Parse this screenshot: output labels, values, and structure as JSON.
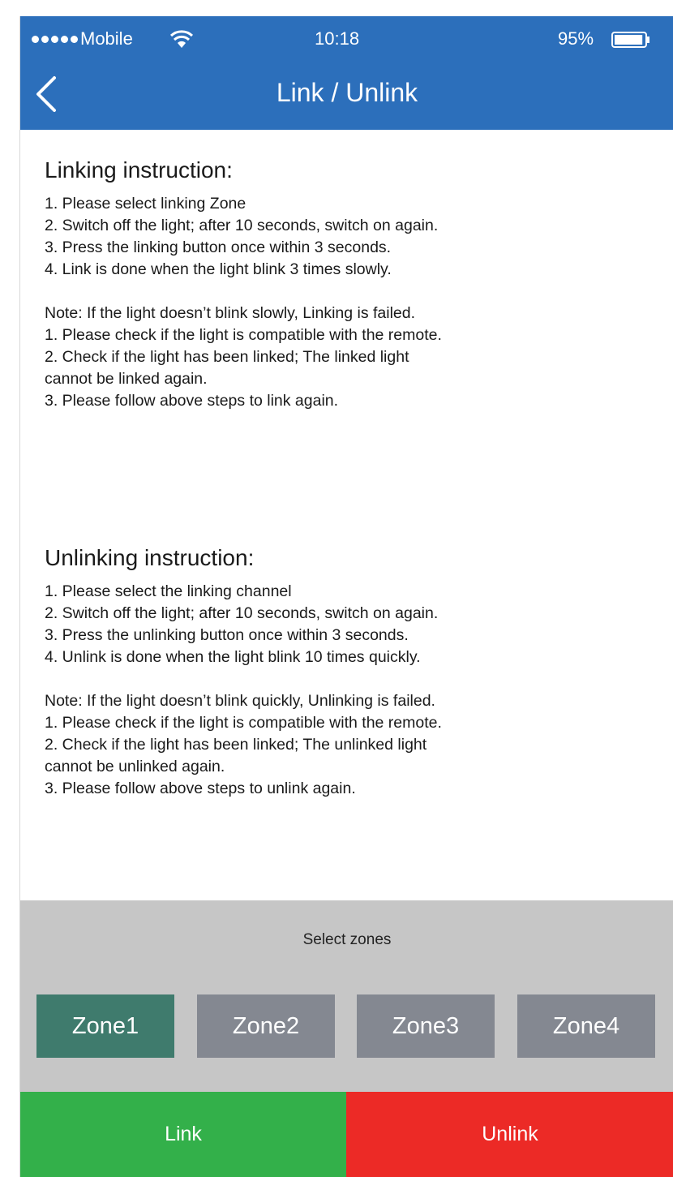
{
  "status_bar": {
    "signal_dots": 5,
    "carrier": "Mobile",
    "time": "10:18",
    "battery": "95%",
    "battery_level": 0.95,
    "wifi_icon": "wifi-icon",
    "battery_icon": "battery-icon"
  },
  "nav": {
    "title": "Link / Unlink",
    "back_icon": "chevron-left-icon"
  },
  "linking": {
    "heading": "Linking instruction:",
    "steps": [
      "1. Please select linking Zone",
      "2. Switch off the light; after 10 seconds, switch on again.",
      "3. Press the linking button once within 3 seconds.",
      "4. Link is done when the light blink 3 times slowly."
    ],
    "note": [
      "Note: If the light doesn’t blink slowly, Linking is failed.",
      "1. Please check if the light is compatible with the remote.",
      "2. Check if the light has been linked; The linked light",
      "cannot be linked again.",
      "3. Please follow above steps to link again."
    ]
  },
  "unlinking": {
    "heading": "Unlinking instruction:",
    "steps": [
      "1. Please select the linking channel",
      "2. Switch off the light; after 10 seconds, switch on again.",
      "3. Press the unlinking button once within 3 seconds.",
      "4. Unlink is done when the light blink 10 times quickly."
    ],
    "note": [
      "Note:  If the light doesn’t blink quickly, Unlinking is failed.",
      "1. Please check if the light is compatible with the remote.",
      "2. Check if the light has been linked; The unlinked light",
      "cannot be unlinked again.",
      "3. Please follow above steps to unlink again."
    ]
  },
  "zones": {
    "label": "Select zones",
    "items": [
      "Zone1",
      "Zone2",
      "Zone3",
      "Zone4"
    ],
    "selected": "Zone1",
    "active_color": "#3f7b6d",
    "inactive_color": "#848891"
  },
  "actions": {
    "link_label": "Link",
    "unlink_label": "Unlink",
    "link_color": "#33b04a",
    "unlink_color": "#ec2a26"
  },
  "colors": {
    "header": "#2c6fbb",
    "zones_panel": "#c6c6c6"
  }
}
